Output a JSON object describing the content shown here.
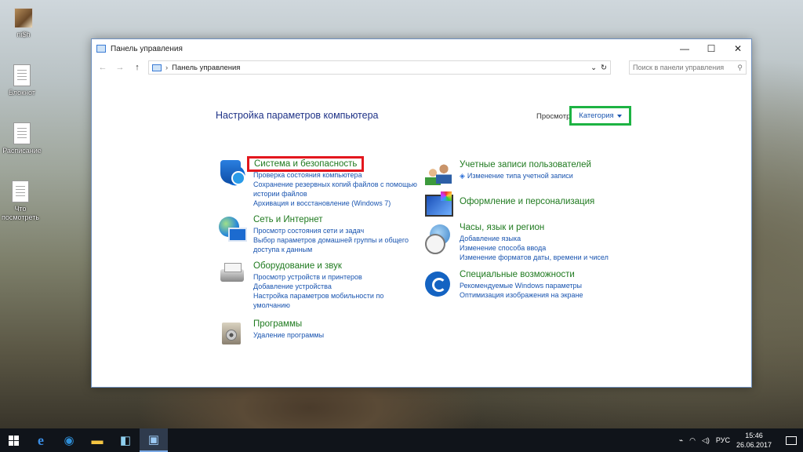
{
  "desktop": {
    "icons": [
      {
        "label": "ni$h"
      },
      {
        "label": "Блокнот"
      },
      {
        "label": "Расписание"
      },
      {
        "label": "Что посмотреть"
      }
    ]
  },
  "window": {
    "title": "Панель управления",
    "controls": {
      "minimize": "—",
      "maximize": "☐",
      "close": "✕"
    }
  },
  "address_bar": {
    "path": "Панель управления",
    "separator": "›",
    "dropdown": "⌄",
    "refresh": "↻",
    "search_placeholder": "Поиск в панели управления"
  },
  "main": {
    "heading": "Настройка параметров компьютера",
    "view_by_label": "Просмотр",
    "view_by_value": "Категория"
  },
  "categories_left": [
    {
      "title": "Система и безопасность",
      "links": [
        "Проверка состояния компьютера",
        "Сохранение резервных копий файлов с помощью",
        "истории файлов",
        "Архивация и восстановление (Windows 7)"
      ]
    },
    {
      "title": "Сеть и Интернет",
      "links": [
        "Просмотр состояния сети и задач",
        "Выбор параметров домашней группы и общего",
        "доступа к данным"
      ]
    },
    {
      "title": "Оборудование и звук",
      "links": [
        "Просмотр устройств и принтеров",
        "Добавление устройства",
        "Настройка параметров мобильности по",
        "умолчанию"
      ]
    },
    {
      "title": "Программы",
      "links": [
        "Удаление программы"
      ]
    }
  ],
  "categories_right": [
    {
      "title": "Учетные записи пользователей",
      "links": [
        "Изменение типа учетной записи"
      ]
    },
    {
      "title": "Оформление и персонализация",
      "links": []
    },
    {
      "title": "Часы, язык и регион",
      "links": [
        "Добавление языка",
        "Изменение способа ввода",
        "Изменение форматов даты, времени и чисел"
      ]
    },
    {
      "title": "Специальные возможности",
      "links": [
        "Рекомендуемые Windows параметры",
        "Оптимизация изображения на экране"
      ]
    }
  ],
  "taskbar": {
    "language": "РУС",
    "time": "15:46",
    "date": "26.06.2017"
  },
  "colors": {
    "highlight_red": "#e3171d",
    "highlight_green": "#1db343",
    "category_title": "#1f7a1f",
    "link": "#1a55b0"
  }
}
